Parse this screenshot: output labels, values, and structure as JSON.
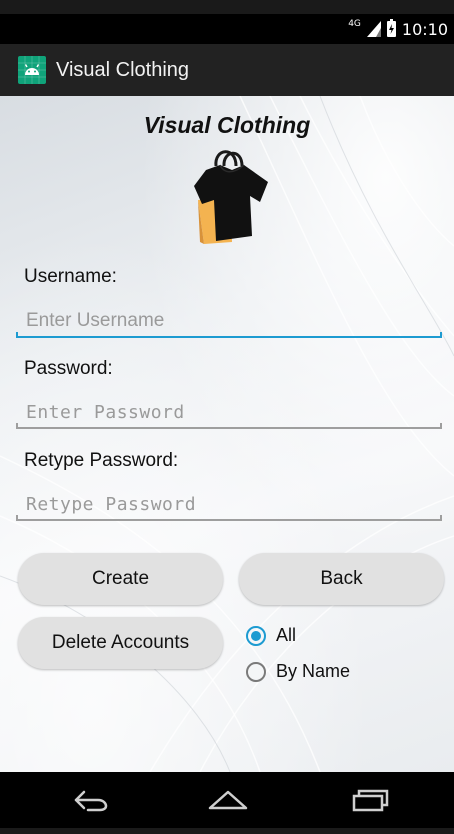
{
  "status_bar": {
    "network": "4G",
    "time": "10:10"
  },
  "action_bar": {
    "title": "Visual Clothing"
  },
  "main": {
    "brand_title": "Visual Clothing",
    "username_label": "Username:",
    "username_placeholder": "Enter Username",
    "username_value": "",
    "password_label": "Password:",
    "password_placeholder": "Enter Password",
    "password_value": "",
    "retype_label": "Retype Password:",
    "retype_placeholder": "Retype Password",
    "retype_value": ""
  },
  "buttons": {
    "create": "Create",
    "back": "Back",
    "delete_accounts": "Delete Accounts"
  },
  "radio": {
    "options": [
      {
        "label": "All",
        "checked": true
      },
      {
        "label": "By Name",
        "checked": false
      }
    ]
  },
  "colors": {
    "accent": "#1d9bd1",
    "app_icon": "#10a37a",
    "action_bar": "#222222",
    "button_bg": "#e1e1e1"
  },
  "icons": {
    "app": "android-icon",
    "logo": "tshirt-shopping-bag-icon",
    "nav_back": "back-icon",
    "nav_home": "home-icon",
    "nav_recents": "recents-icon"
  }
}
